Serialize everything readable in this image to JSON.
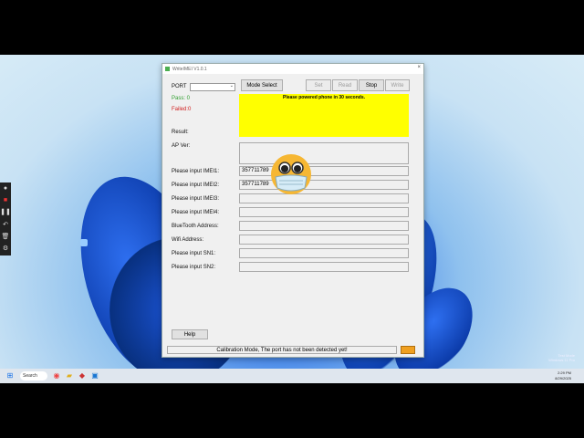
{
  "window": {
    "title": "WriteIMEI V1.0.1",
    "close_glyph": "×"
  },
  "toolbar": {
    "port_label": "PORT",
    "port_value": "",
    "mode_select": "Mode Select",
    "set": "Set",
    "read": "Read",
    "stop": "Stop",
    "write": "Write"
  },
  "counters": {
    "pass": "Pass: 0",
    "failed": "Failed:0",
    "result": "Result:"
  },
  "message": "Please powered phone in 30 seconds.",
  "fields": {
    "ap_ver": "AP Ver:",
    "imei1_label": "Please input IMEI1:",
    "imei1_value": "357711789",
    "imei2_label": "Please input IMEI2:",
    "imei2_value": "357711789",
    "imei3_label": "Please input IMEI3:",
    "imei4_label": "Please input IMEI4:",
    "bt_label": "BlueTooth Address:",
    "wifi_label": "Wifi Address:",
    "sn1_label": "Please input SN1:",
    "sn2_label": "Please input SN2:"
  },
  "help": "Help",
  "status": "Calibration Mode, The port has not been detected yet!",
  "colors": {
    "pass": "#2e9e2e",
    "failed": "#d02020",
    "banner": "#ffff00",
    "status_indicator": "#f0a020"
  },
  "taskbar": {
    "search": "Search",
    "time": "2:29 PM",
    "date": "8/29/2025"
  },
  "watermark": {
    "line1": "Test Mode",
    "line2": "Windows 11 Pro"
  },
  "recorder": {
    "icons": [
      "record-icon",
      "stop-icon",
      "pause-icon",
      "undo-icon",
      "trash-icon",
      "settings-icon"
    ]
  }
}
